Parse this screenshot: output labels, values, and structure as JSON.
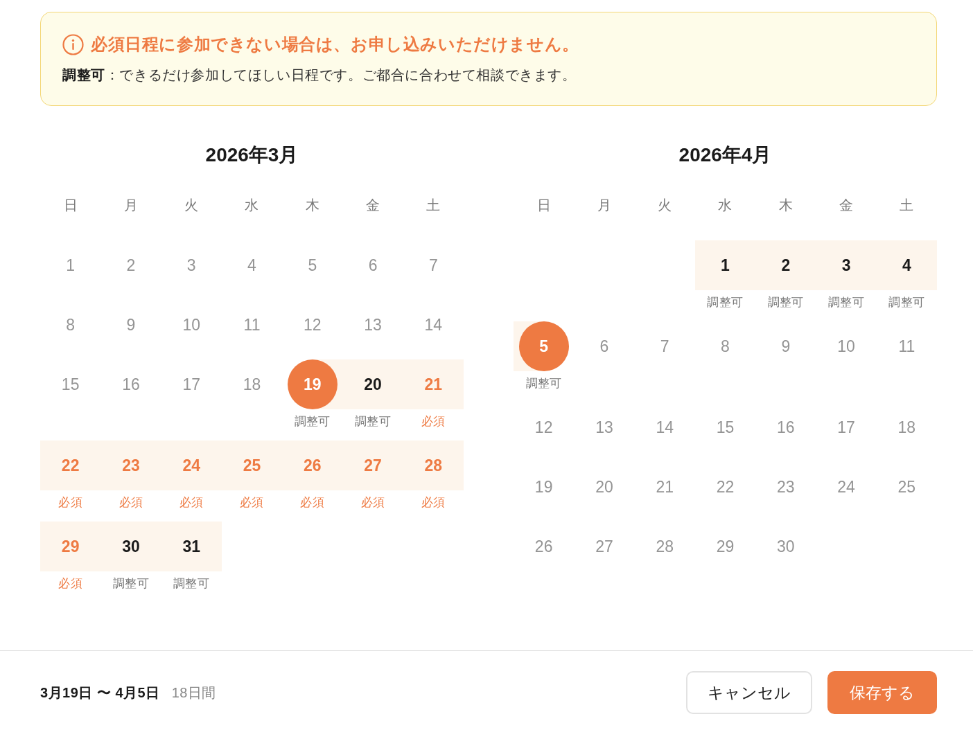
{
  "notice": {
    "title": "必須日程に参加できない場合は、お申し込みいただけません。",
    "note": "**調整可**：できるだけ参加してほしい日程です。ご都合に合わせて相談できます。"
  },
  "calendars": [
    {
      "title": "2026年3月",
      "weekdays": [
        "日",
        "月",
        "火",
        "水",
        "木",
        "金",
        "土"
      ],
      "weeks": [
        [
          {
            "day": "1",
            "in_range": false,
            "selected": false
          },
          {
            "day": "2",
            "in_range": false,
            "selected": false
          },
          {
            "day": "3",
            "in_range": false,
            "selected": false
          },
          {
            "day": "4",
            "in_range": false,
            "selected": false
          },
          {
            "day": "5",
            "in_range": false,
            "selected": false
          },
          {
            "day": "6",
            "in_range": false,
            "selected": false
          },
          {
            "day": "7",
            "in_range": false,
            "selected": false
          }
        ],
        [
          {
            "day": "8",
            "in_range": false,
            "selected": false
          },
          {
            "day": "9",
            "in_range": false,
            "selected": false
          },
          {
            "day": "10",
            "in_range": false,
            "selected": false
          },
          {
            "day": "11",
            "in_range": false,
            "selected": false
          },
          {
            "day": "12",
            "in_range": false,
            "selected": false
          },
          {
            "day": "13",
            "in_range": false,
            "selected": false
          },
          {
            "day": "14",
            "in_range": false,
            "selected": false
          }
        ],
        [
          {
            "day": "15",
            "in_range": false,
            "selected": false
          },
          {
            "day": "16",
            "in_range": false,
            "selected": false
          },
          {
            "day": "17",
            "in_range": false,
            "selected": false
          },
          {
            "day": "18",
            "in_range": false,
            "selected": false
          },
          {
            "day": "19",
            "in_range": true,
            "selected": true,
            "kind": "flexible",
            "label": "調整可"
          },
          {
            "day": "20",
            "in_range": true,
            "selected": false,
            "kind": "flexible",
            "label": "調整可"
          },
          {
            "day": "21",
            "in_range": true,
            "selected": false,
            "kind": "required",
            "label": "必須"
          }
        ],
        [
          {
            "day": "22",
            "in_range": true,
            "selected": false,
            "kind": "required",
            "label": "必須"
          },
          {
            "day": "23",
            "in_range": true,
            "selected": false,
            "kind": "required",
            "label": "必須"
          },
          {
            "day": "24",
            "in_range": true,
            "selected": false,
            "kind": "required",
            "label": "必須"
          },
          {
            "day": "25",
            "in_range": true,
            "selected": false,
            "kind": "required",
            "label": "必須"
          },
          {
            "day": "26",
            "in_range": true,
            "selected": false,
            "kind": "required",
            "label": "必須"
          },
          {
            "day": "27",
            "in_range": true,
            "selected": false,
            "kind": "required",
            "label": "必須"
          },
          {
            "day": "28",
            "in_range": true,
            "selected": false,
            "kind": "required",
            "label": "必須"
          }
        ],
        [
          {
            "day": "29",
            "in_range": true,
            "selected": false,
            "kind": "required",
            "label": "必須"
          },
          {
            "day": "30",
            "in_range": true,
            "selected": false,
            "kind": "flexible",
            "label": "調整可"
          },
          {
            "day": "31",
            "in_range": true,
            "selected": false,
            "kind": "flexible",
            "label": "調整可"
          }
        ]
      ]
    },
    {
      "title": "2026年4月",
      "weekdays": [
        "日",
        "月",
        "火",
        "水",
        "木",
        "金",
        "土"
      ],
      "weeks": [
        [
          {
            "day": "1",
            "in_range": true,
            "selected": false,
            "kind": "flexible",
            "label": "調整可"
          },
          {
            "day": "2",
            "in_range": true,
            "selected": false,
            "kind": "flexible",
            "label": "調整可"
          },
          {
            "day": "3",
            "in_range": true,
            "selected": false,
            "kind": "flexible",
            "label": "調整可"
          },
          {
            "day": "4",
            "in_range": true,
            "selected": false,
            "kind": "flexible",
            "label": "調整可"
          }
        ],
        [
          {
            "day": "5",
            "in_range": true,
            "selected": true,
            "kind": "flexible",
            "label": "調整可"
          },
          {
            "day": "6",
            "in_range": false,
            "selected": false
          },
          {
            "day": "7",
            "in_range": false,
            "selected": false
          },
          {
            "day": "8",
            "in_range": false,
            "selected": false
          },
          {
            "day": "9",
            "in_range": false,
            "selected": false
          },
          {
            "day": "10",
            "in_range": false,
            "selected": false
          },
          {
            "day": "11",
            "in_range": false,
            "selected": false
          }
        ],
        [
          {
            "day": "12",
            "in_range": false,
            "selected": false
          },
          {
            "day": "13",
            "in_range": false,
            "selected": false
          },
          {
            "day": "14",
            "in_range": false,
            "selected": false
          },
          {
            "day": "15",
            "in_range": false,
            "selected": false
          },
          {
            "day": "16",
            "in_range": false,
            "selected": false
          },
          {
            "day": "17",
            "in_range": false,
            "selected": false
          },
          {
            "day": "18",
            "in_range": false,
            "selected": false
          }
        ],
        [
          {
            "day": "19",
            "in_range": false,
            "selected": false
          },
          {
            "day": "20",
            "in_range": false,
            "selected": false
          },
          {
            "day": "21",
            "in_range": false,
            "selected": false
          },
          {
            "day": "22",
            "in_range": false,
            "selected": false
          },
          {
            "day": "23",
            "in_range": false,
            "selected": false
          },
          {
            "day": "24",
            "in_range": false,
            "selected": false
          },
          {
            "day": "25",
            "in_range": false,
            "selected": false
          }
        ],
        [
          {
            "day": "26",
            "in_range": false,
            "selected": false
          },
          {
            "day": "27",
            "in_range": false,
            "selected": false
          },
          {
            "day": "28",
            "in_range": false,
            "selected": false
          },
          {
            "day": "29",
            "in_range": false,
            "selected": false
          },
          {
            "day": "30",
            "in_range": false,
            "selected": false
          }
        ]
      ]
    }
  ],
  "footer": {
    "range": "3月19日 〜 4月5日",
    "duration": "18日間",
    "buttons": [
      {
        "label": "キャンセル",
        "kind": "secondary"
      },
      {
        "label": "保存する",
        "kind": "primary"
      }
    ]
  }
}
